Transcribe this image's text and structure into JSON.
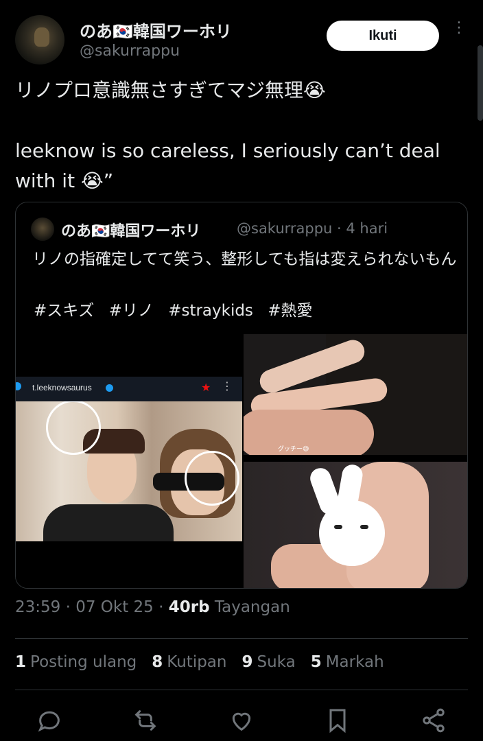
{
  "author": {
    "display_name": "のあ🇰🇷韓国ワーホリ",
    "handle": "@sakurrappu"
  },
  "follow_label": "Ikuti",
  "more_label": "⋮",
  "tweet": {
    "text_jp": "リノプロ意識無さすぎてマジ無理😭",
    "text_translation": "leeknow is so careless, I seriously can’t deal with it 😭”"
  },
  "quote": {
    "display_name": "のあ🇰🇷韓国ワーホリ",
    "meta": "@sakurrappu · 4 hari",
    "text": "リノの指確定してて笑う、整形しても指は変えられないもん",
    "hashtags": [
      "#スキズ",
      "#リノ",
      "#straykids",
      "#熱愛"
    ],
    "media_left": {
      "account": "t.leeknowsaurus",
      "star": "★",
      "dots": "⋮"
    },
    "media_right_top_caption": "グッチー😅"
  },
  "timestamp": {
    "time_date": "23:59 · 07 Okt 25 · ",
    "views_count": "40rb",
    "views_label": " Tayangan"
  },
  "stats": [
    {
      "count": "1",
      "label": "Posting ulang"
    },
    {
      "count": "8",
      "label": "Kutipan"
    },
    {
      "count": "9",
      "label": "Suka"
    },
    {
      "count": "5",
      "label": "Markah"
    }
  ],
  "actions": [
    "reply-icon",
    "retweet-icon",
    "like-icon",
    "bookmark-icon",
    "share-icon"
  ],
  "colors": {
    "background": "#000000",
    "text_primary": "#e7e9ea",
    "text_secondary": "#71767b",
    "border": "#2f3336",
    "follow_bg": "#ffffff"
  }
}
